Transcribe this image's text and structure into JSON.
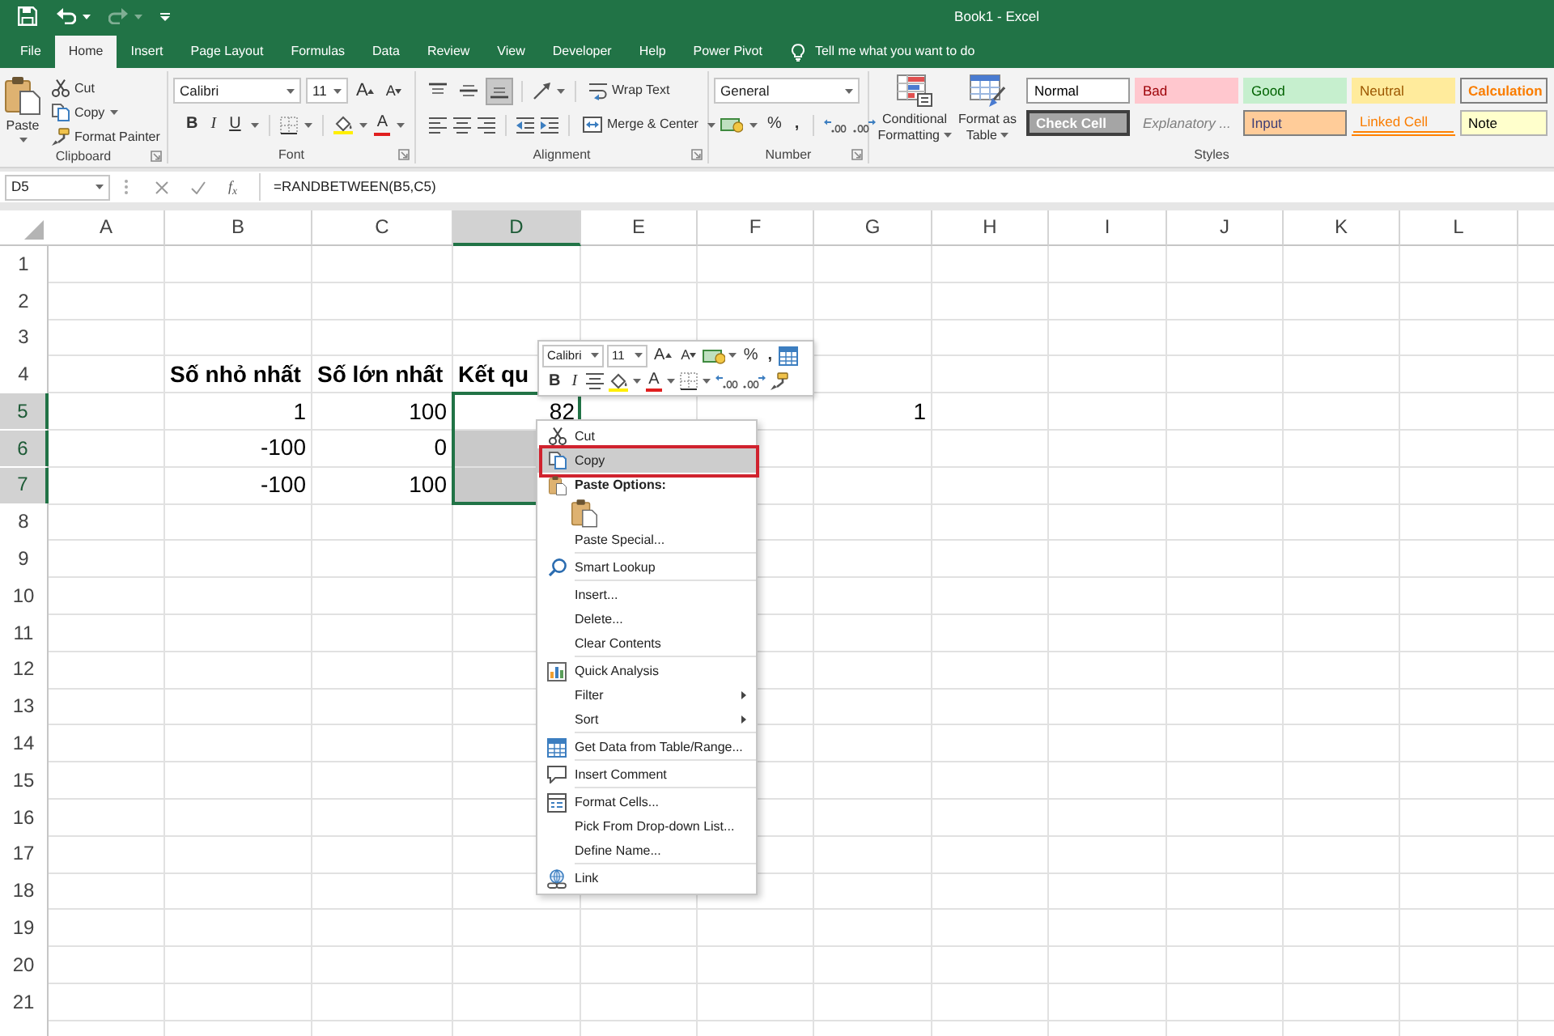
{
  "title_bar": {
    "title": "Book1 - Excel",
    "quick_access": [
      {
        "disabled": false
      },
      {
        "disabled": false
      },
      {
        "disabled": true
      }
    ]
  },
  "tabs": [
    {
      "label": "File",
      "selected": false
    },
    {
      "label": "Home",
      "selected": true
    },
    {
      "label": "Insert",
      "selected": false
    },
    {
      "label": "Page Layout",
      "selected": false
    },
    {
      "label": "Formulas",
      "selected": false
    },
    {
      "label": "Data",
      "selected": false
    },
    {
      "label": "Review",
      "selected": false
    },
    {
      "label": "View",
      "selected": false
    },
    {
      "label": "Developer",
      "selected": false
    },
    {
      "label": "Help",
      "selected": false
    },
    {
      "label": "Power Pivot",
      "selected": false
    }
  ],
  "tell_me": {
    "placeholder": "Tell me what you want to do"
  },
  "ribbon": {
    "clipboard": {
      "label": "Clipboard",
      "paste": "Paste",
      "commands": [
        "Cut",
        "Copy",
        "Format Painter"
      ]
    },
    "font": {
      "label": "Font",
      "font_name": "Calibri",
      "font_size": "11",
      "grow": "A",
      "shrink": "A",
      "bold": "B",
      "italic": "I",
      "underline": "U",
      "font_color": "A"
    },
    "alignment": {
      "label": "Alignment",
      "vertical": [
        {
          "selected": false
        },
        {
          "selected": false
        },
        {
          "selected": true
        }
      ],
      "wrap_text": "Wrap Text",
      "merge": "Merge & Center"
    },
    "number": {
      "label": "Number",
      "format": "General",
      "percent": "%",
      "comma": ","
    },
    "styles": {
      "label": "Styles",
      "conditional_formatting": "Conditional Formatting",
      "format_as_table": "Format as Table",
      "cell_styles": [
        {
          "label": "Normal",
          "kind": "normal"
        },
        {
          "label": "Bad",
          "kind": "bad"
        },
        {
          "label": "Good",
          "kind": "good"
        },
        {
          "label": "Neutral",
          "kind": "neutral"
        },
        {
          "label": "Calculation",
          "kind": "calculation"
        },
        {
          "label": "Check Cell",
          "kind": "check"
        },
        {
          "label": "Explanatory ...",
          "kind": "explanatory"
        },
        {
          "label": "Input",
          "kind": "input"
        },
        {
          "label": "Linked Cell",
          "kind": "linked"
        },
        {
          "label": "Note",
          "kind": "note"
        }
      ]
    }
  },
  "formula_bar": {
    "name_box": "D5",
    "function_label": "f$_{x}$",
    "formula": "=RANDBETWEEN(B5,C5)"
  },
  "sheet": {
    "columns": [
      {
        "label": "A",
        "selected": false
      },
      {
        "label": "B",
        "selected": false
      },
      {
        "label": "C",
        "selected": false
      },
      {
        "label": "D",
        "selected": true
      },
      {
        "label": "E",
        "selected": false
      },
      {
        "label": "F",
        "selected": false
      },
      {
        "label": "G",
        "selected": false
      },
      {
        "label": "H",
        "selected": false
      },
      {
        "label": "I",
        "selected": false
      },
      {
        "label": "J",
        "selected": false
      },
      {
        "label": "K",
        "selected": false
      },
      {
        "label": "L",
        "selected": false
      }
    ],
    "rows": [
      {
        "label": "1",
        "selected": false
      },
      {
        "label": "2",
        "selected": false
      },
      {
        "label": "3",
        "selected": false
      },
      {
        "label": "4",
        "selected": false,
        "cells": [
          null,
          {
            "text": "Số nhỏ nhất",
            "kind": "text",
            "bold": true,
            "selected": false
          },
          {
            "text": "Số lớn nhất",
            "kind": "text",
            "bold": true,
            "selected": false
          },
          {
            "text": "Kết qu",
            "kind": "text",
            "bold": true,
            "selected": false
          }
        ]
      },
      {
        "label": "5",
        "selected": true,
        "cells": [
          null,
          {
            "text": "1",
            "kind": "number",
            "bold": false,
            "selected": false
          },
          {
            "text": "100",
            "kind": "number",
            "bold": false,
            "selected": false
          },
          {
            "text": "82",
            "kind": "number",
            "bold": false,
            "active": true
          },
          null,
          null,
          {
            "text": "1",
            "kind": "number",
            "bold": false,
            "selected": false
          }
        ]
      },
      {
        "label": "6",
        "selected": true,
        "cells": [
          null,
          {
            "text": "-100",
            "kind": "number",
            "bold": false,
            "selected": false
          },
          {
            "text": "0",
            "kind": "number",
            "bold": false,
            "selected": false
          },
          {
            "selected": true
          }
        ]
      },
      {
        "label": "7",
        "selected": true,
        "cells": [
          null,
          {
            "text": "-100",
            "kind": "number",
            "bold": false,
            "selected": false
          },
          {
            "text": "100",
            "kind": "number",
            "bold": false,
            "selected": false
          },
          {
            "selected": true
          }
        ]
      },
      {
        "label": "8",
        "selected": false
      },
      {
        "label": "9",
        "selected": false
      },
      {
        "label": "10",
        "selected": false
      },
      {
        "label": "11",
        "selected": false
      },
      {
        "label": "12",
        "selected": false
      },
      {
        "label": "13",
        "selected": false
      },
      {
        "label": "14",
        "selected": false
      },
      {
        "label": "15",
        "selected": false
      },
      {
        "label": "16",
        "selected": false
      },
      {
        "label": "17",
        "selected": false
      },
      {
        "label": "18",
        "selected": false
      },
      {
        "label": "19",
        "selected": false
      },
      {
        "label": "20",
        "selected": false
      },
      {
        "label": "21",
        "selected": false
      }
    ]
  },
  "mini_toolbar": {
    "font_name": "Calibri",
    "font_size": "11",
    "grow": "A",
    "shrink": "A",
    "percent": "%",
    "comma": ",",
    "bold": "B",
    "italic": "I",
    "font_color": "A"
  },
  "context_menu": {
    "sections": [
      {
        "items": [
          {
            "label": "Cut",
            "kind": "command",
            "selected": false
          },
          {
            "label": "Copy",
            "kind": "command",
            "selected": true,
            "outlined": true
          },
          {
            "label": "Paste Options:",
            "kind": "header",
            "selected": false
          },
          {
            "kind": "paste",
            "selected": false
          },
          {
            "label": "Paste Special...",
            "kind": "command",
            "selected": false
          }
        ]
      },
      {
        "items": [
          {
            "label": "Smart Lookup",
            "kind": "command",
            "selected": false
          }
        ]
      },
      {
        "items": [
          {
            "label": "Insert...",
            "kind": "command",
            "selected": false
          },
          {
            "label": "Delete...",
            "kind": "command",
            "selected": false
          },
          {
            "label": "Clear Contents",
            "kind": "command",
            "selected": false
          }
        ]
      },
      {
        "items": [
          {
            "label": "Quick Analysis",
            "kind": "command",
            "selected": false
          },
          {
            "label": "Filter",
            "kind": "submenu",
            "selected": false
          },
          {
            "label": "Sort",
            "kind": "submenu",
            "selected": false
          }
        ]
      },
      {
        "items": [
          {
            "label": "Get Data from Table/Range...",
            "kind": "command",
            "selected": false
          }
        ]
      },
      {
        "items": [
          {
            "label": "Insert Comment",
            "kind": "command",
            "selected": false
          }
        ]
      },
      {
        "items": [
          {
            "label": "Format Cells...",
            "kind": "command",
            "selected": false
          },
          {
            "label": "Pick From Drop-down List...",
            "kind": "command",
            "selected": false
          },
          {
            "label": "Define Name...",
            "kind": "command",
            "selected": false
          }
        ]
      },
      {
        "items": [
          {
            "label": "Link",
            "kind": "command",
            "selected": false
          }
        ]
      }
    ]
  }
}
